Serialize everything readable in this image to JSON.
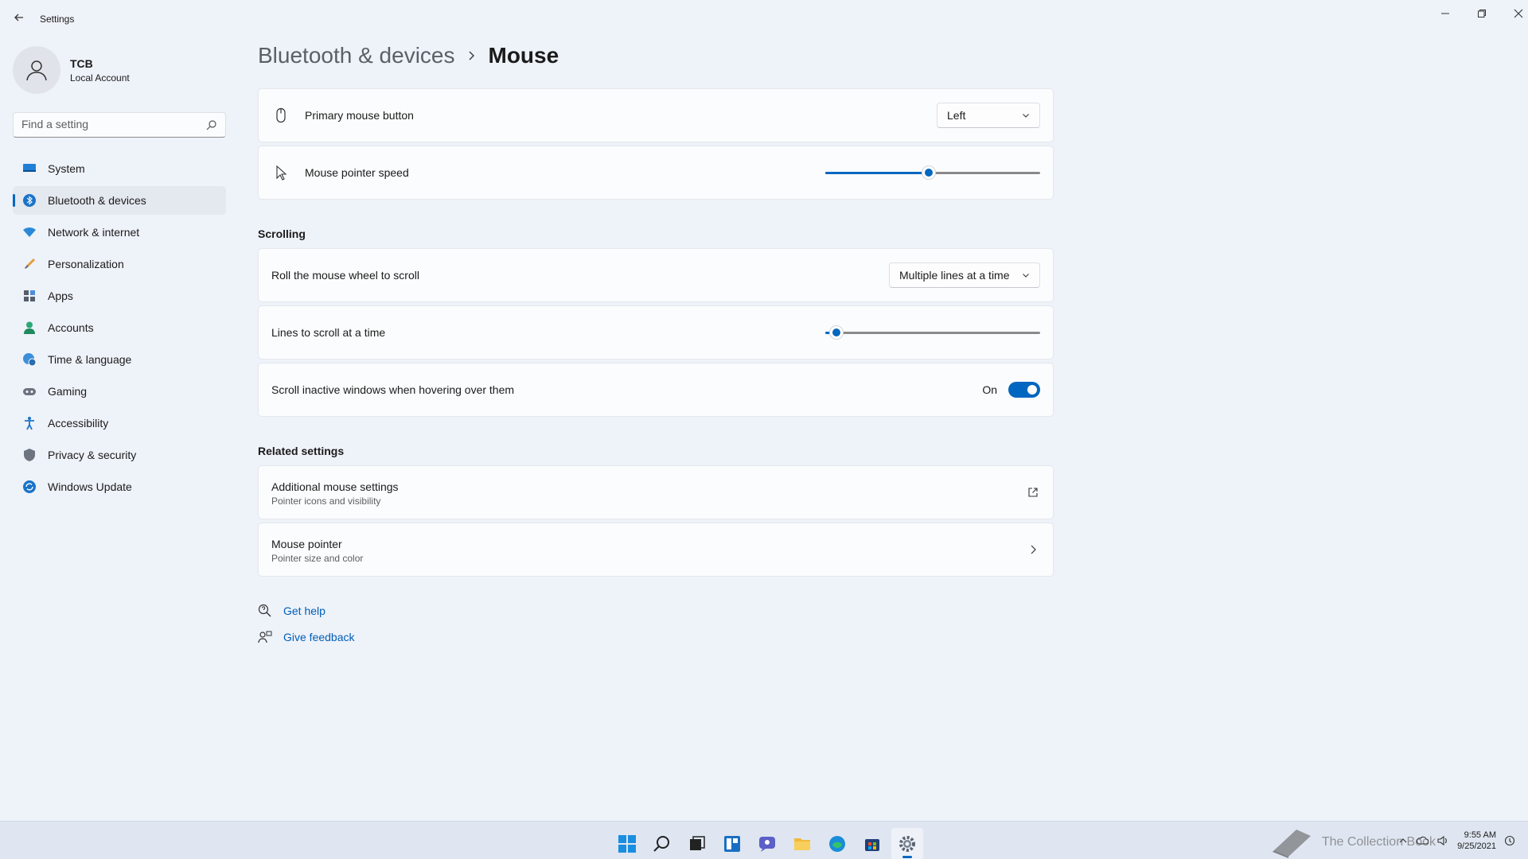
{
  "window": {
    "title": "Settings"
  },
  "profile": {
    "name": "TCB",
    "account_type": "Local Account"
  },
  "search": {
    "placeholder": "Find a setting"
  },
  "sidebar": {
    "items": [
      {
        "label": "System",
        "icon": "system-icon",
        "active": false
      },
      {
        "label": "Bluetooth & devices",
        "icon": "bluetooth-icon",
        "active": true
      },
      {
        "label": "Network & internet",
        "icon": "wifi-icon",
        "active": false
      },
      {
        "label": "Personalization",
        "icon": "brush-icon",
        "active": false
      },
      {
        "label": "Apps",
        "icon": "apps-icon",
        "active": false
      },
      {
        "label": "Accounts",
        "icon": "accounts-icon",
        "active": false
      },
      {
        "label": "Time & language",
        "icon": "globe-clock-icon",
        "active": false
      },
      {
        "label": "Gaming",
        "icon": "gamepad-icon",
        "active": false
      },
      {
        "label": "Accessibility",
        "icon": "accessibility-icon",
        "active": false
      },
      {
        "label": "Privacy & security",
        "icon": "shield-icon",
        "active": false
      },
      {
        "label": "Windows Update",
        "icon": "update-icon",
        "active": false
      }
    ]
  },
  "breadcrumb": {
    "parent": "Bluetooth & devices",
    "current": "Mouse"
  },
  "main": {
    "primary_button": {
      "label": "Primary mouse button",
      "value": "Left"
    },
    "pointer_speed": {
      "label": "Mouse pointer speed",
      "value_fraction": 0.48
    },
    "scrolling": {
      "heading": "Scrolling",
      "roll_wheel": {
        "label": "Roll the mouse wheel to scroll",
        "value": "Multiple lines at a time"
      },
      "lines": {
        "label": "Lines to scroll at a time",
        "value_fraction": 0.05
      },
      "inactive": {
        "label": "Scroll inactive windows when hovering over them",
        "state": "On"
      }
    },
    "related": {
      "heading": "Related settings",
      "additional": {
        "title": "Additional mouse settings",
        "subtitle": "Pointer icons and visibility"
      },
      "pointer": {
        "title": "Mouse pointer",
        "subtitle": "Pointer size and color"
      }
    },
    "help": {
      "get_help": "Get help",
      "give_feedback": "Give feedback"
    }
  },
  "taskbar": {
    "apps": [
      "start-icon",
      "search-icon",
      "task-view-icon",
      "widgets-icon",
      "chat-icon",
      "file-explorer-icon",
      "edge-icon",
      "store-icon",
      "settings-icon"
    ],
    "time": "9:55 AM",
    "date": "9/25/2021",
    "watermark": "The Collection Book"
  },
  "colors": {
    "accent": "#0067c0",
    "background": "#eef2f9"
  }
}
